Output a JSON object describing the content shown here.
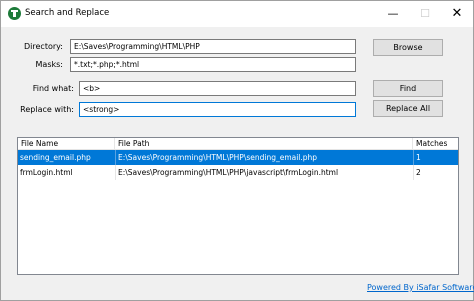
{
  "window": {
    "title": "Search and Replace",
    "controls": {
      "minimize": "—",
      "maximize": "☐",
      "close": "✕"
    }
  },
  "form": {
    "directory_label": "Directory:",
    "directory_value": "E:\\Saves\\Programming\\HTML\\PHP",
    "masks_label": "Masks:",
    "masks_value": "*.txt;*.php;*.html",
    "find_label": "Find what:",
    "find_value": "<b>",
    "replace_label": "Replace with:",
    "replace_value": "<strong>"
  },
  "buttons": {
    "browse": "Browse",
    "find": "Find",
    "replace_all": "Replace All"
  },
  "results": {
    "columns": [
      "File Name",
      "File Path",
      "Matches"
    ],
    "rows": [
      {
        "file_name": "sending_email.php",
        "file_path": "E:\\Saves\\Programming\\HTML\\PHP\\sending_email.php",
        "matches": "1",
        "selected": true
      },
      {
        "file_name": "frmLogin.html",
        "file_path": "E:\\Saves\\Programming\\HTML\\PHP\\javascript\\frmLogin.html",
        "matches": "2",
        "selected": false
      }
    ]
  },
  "footer": {
    "link_text": "Powered By iSafar Software"
  },
  "colors": {
    "selection": "#0078d7",
    "link": "#0066cc",
    "app_icon": "#1e7b3a"
  },
  "icons": {
    "app": "app-logo-icon"
  }
}
